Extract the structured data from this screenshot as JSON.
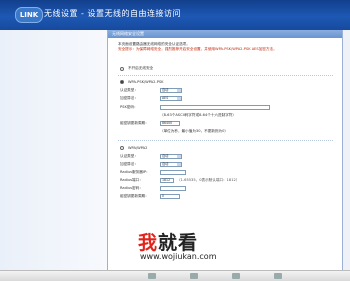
{
  "header": {
    "logo_text": "LINK",
    "title": "无线设置 - 设置无线的自由连接访问"
  },
  "panel": {
    "heading": "无线网络安全设置",
    "intro_line1": "本页面设置路由器无线网络的安全认证选项。",
    "intro_warning": "安全提示：为保障网络安全，强烈推荐开启安全设置，并使用WPA-PSK/WPA2-PSK AES加密方法。",
    "option_off": "不开启无线安全",
    "option_wpa_psk": "WPA-PSK/WPA2-PSK",
    "auth_label": "认证类型：",
    "auth_value": "自动",
    "enc_label": "加密算法：",
    "enc_value": "AES",
    "psk_label": "PSK密码：",
    "psk_value": "",
    "psk_note": "（8-63个ASCII码字符或8-64个十六进制字符）",
    "group_label": "组密钥更新周期：",
    "group_value": "86400",
    "group_note": "（单位为秒，最小值为30，不更新则为0）",
    "option_wpa": "WPA/WPA2",
    "auth2_label": "认证类型：",
    "auth2_value": "自动",
    "enc2_label": "加密算法：",
    "enc2_value": "自动",
    "radius_ip_label": "Radius服务器IP：",
    "radius_port_label": "Radius端口：",
    "radius_port_value": "1812",
    "radius_port_note": "（1-65535，0表示默认端口：1812）",
    "radius_pwd_label": "Radius密码：",
    "group2_label": "组密钥更新周期：",
    "group2_value": "0"
  },
  "watermark": {
    "part1": "我",
    "part2": "就看",
    "url": "www.wojiukan.com"
  }
}
